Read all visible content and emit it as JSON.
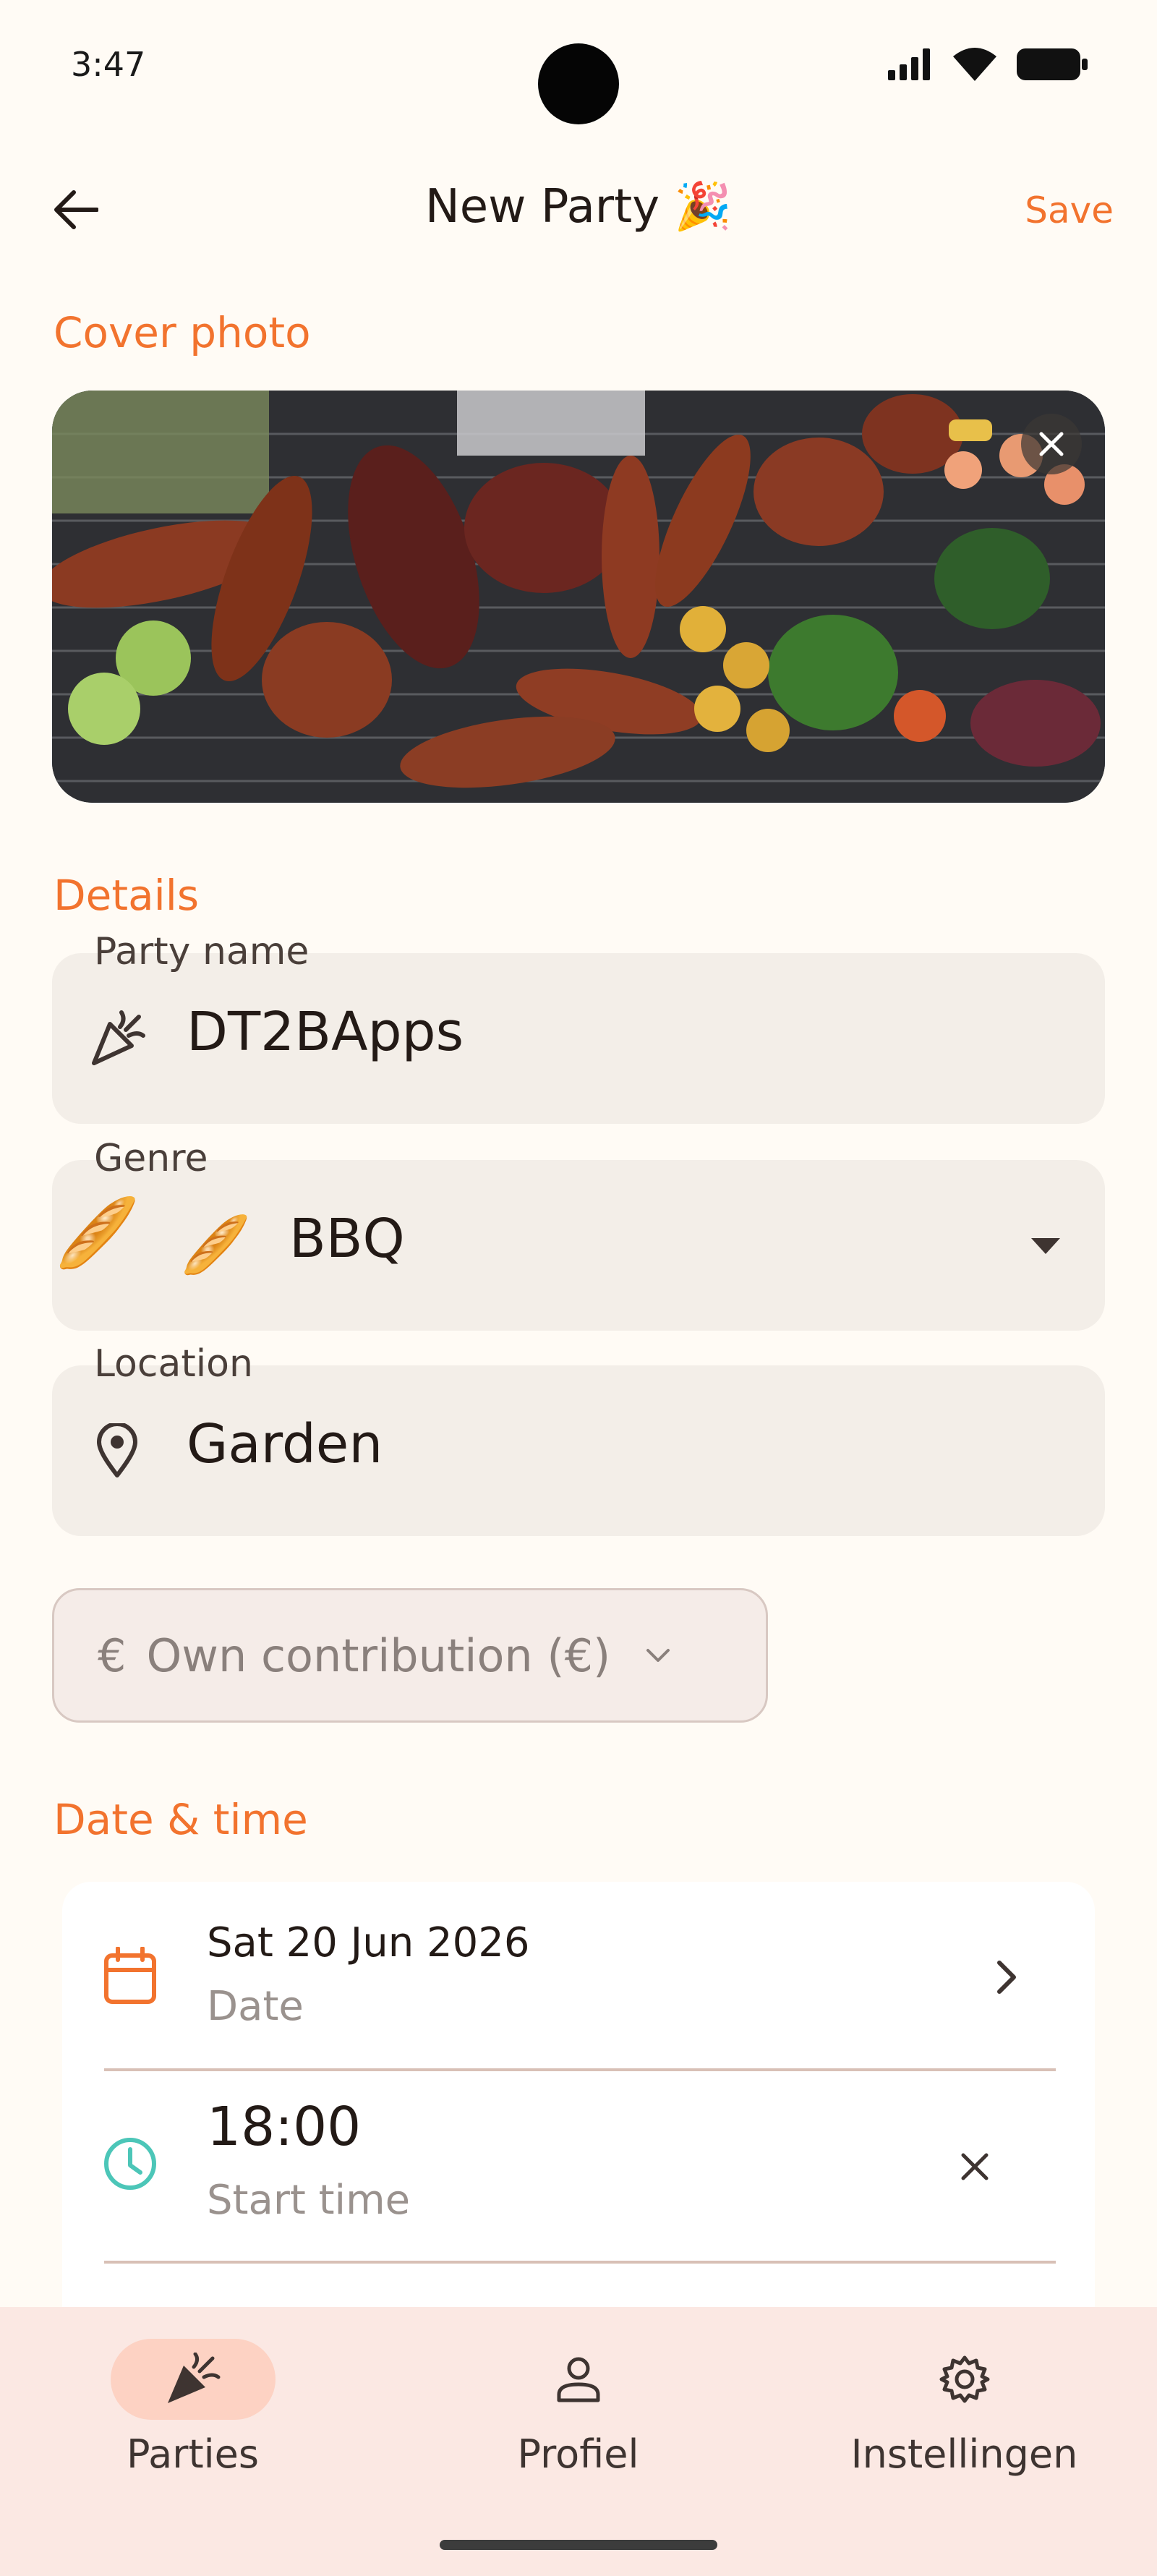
{
  "status_bar": {
    "time": "3:47",
    "icons": [
      "signal-icon",
      "wifi-icon",
      "battery-icon"
    ]
  },
  "app_bar": {
    "title": "New Party 🎉",
    "save_label": "Save",
    "back_icon": "arrow-back-icon"
  },
  "cover": {
    "section_label": "Cover photo",
    "remove_icon": "close-icon"
  },
  "details": {
    "section_label": "Details",
    "party_name": {
      "label": "Party name",
      "value": "DT2BApps",
      "icon": "celebration-icon"
    },
    "genre": {
      "label": "Genre",
      "value": "BBQ",
      "emoji": "🥖",
      "icon": "chevron-down-icon"
    },
    "location": {
      "label": "Location",
      "value": "Garden",
      "icon": "location-pin-icon"
    },
    "contribution": {
      "label": "Own contribution (€)",
      "currency_symbol": "€"
    }
  },
  "date_time": {
    "section_label": "Date & time",
    "date": {
      "value": "Sat 20 Jun 2026",
      "label": "Date"
    },
    "start_time": {
      "value": "18:00",
      "label": "Start time"
    }
  },
  "bottom_nav": {
    "items": [
      {
        "label": "Parties",
        "icon": "celebration-icon",
        "active": true
      },
      {
        "label": "Profiel",
        "icon": "person-icon",
        "active": false
      },
      {
        "label": "Instellingen",
        "icon": "gear-icon",
        "active": false
      }
    ]
  },
  "colors": {
    "accent": "#F2732E",
    "background": "#FFFBF5",
    "field_fill": "#F3EEE8",
    "nav_background": "#FBE8E3",
    "active_pill": "#FDD2C3",
    "clock_icon": "#4CC6B8"
  }
}
